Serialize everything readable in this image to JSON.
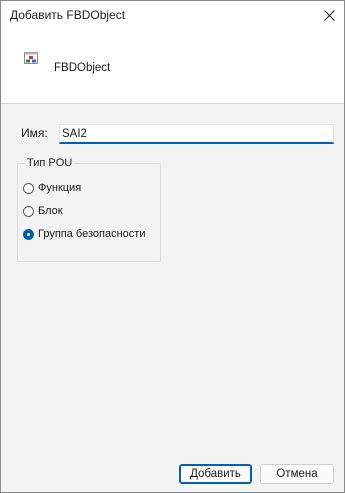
{
  "window": {
    "title": "Добавить FBDObject",
    "close_icon": "close-icon"
  },
  "header": {
    "object_icon": "fbd-object-icon",
    "object_name": "FBDObject"
  },
  "form": {
    "name_label": "Имя:",
    "name_value": "SAI2"
  },
  "pou_type": {
    "legend": "Тип POU",
    "options": [
      {
        "label": "Функция",
        "selected": false
      },
      {
        "label": "Блок",
        "selected": false
      },
      {
        "label": "Группа безопасности",
        "selected": true
      }
    ]
  },
  "buttons": {
    "ok_label": "Добавить",
    "cancel_label": "Отмена"
  },
  "colors": {
    "accent": "#005fb8"
  }
}
